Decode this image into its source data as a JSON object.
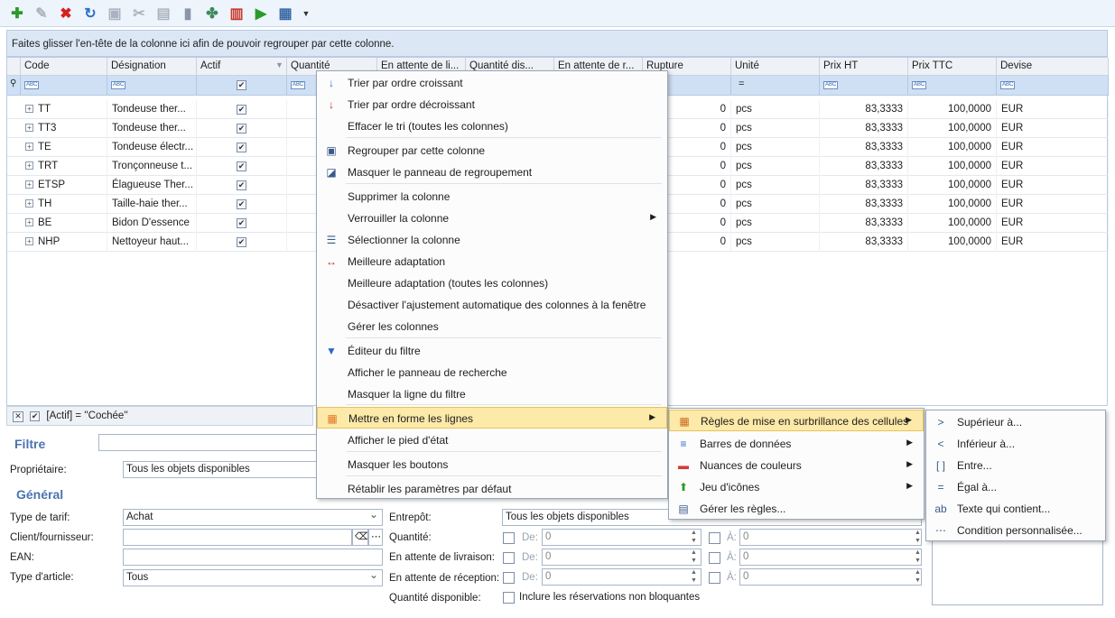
{
  "toolbar": {
    "icons": [
      "add-icon",
      "wrench-icon",
      "delete-icon",
      "refresh-icon",
      "edit-icon",
      "cut-icon",
      "paste-icon",
      "document-icon",
      "branch-icon",
      "chart-icon",
      "play-icon",
      "view-icon",
      "dropdown-arrow-icon"
    ]
  },
  "group_panel": {
    "text": "Faites glisser l'en-tête de la colonne ici afin de pouvoir regrouper par cette colonne."
  },
  "grid": {
    "columns": [
      "Code",
      "Désignation",
      "Actif",
      "Quantité",
      "En attente de li...",
      "Quantité dis...",
      "En attente de r...",
      "Rupture",
      "Unité",
      "Prix HT",
      "Prix TTC",
      "Devise"
    ],
    "rows": [
      {
        "code": "TT",
        "designation": "Tondeuse ther...",
        "rupture": "0",
        "unite": "pcs",
        "prix_ht": "83,3333",
        "prix_ttc": "100,0000",
        "devise": "EUR"
      },
      {
        "code": "TT3",
        "designation": "Tondeuse ther...",
        "rupture": "0",
        "unite": "pcs",
        "prix_ht": "83,3333",
        "prix_ttc": "100,0000",
        "devise": "EUR"
      },
      {
        "code": "TE",
        "designation": "Tondeuse électr...",
        "rupture": "0",
        "unite": "pcs",
        "prix_ht": "83,3333",
        "prix_ttc": "100,0000",
        "devise": "EUR"
      },
      {
        "code": "TRT",
        "designation": "Tronçonneuse t...",
        "rupture": "0",
        "unite": "pcs",
        "prix_ht": "83,3333",
        "prix_ttc": "100,0000",
        "devise": "EUR"
      },
      {
        "code": "ETSP",
        "designation": "Élagueuse Ther...",
        "rupture": "0",
        "unite": "pcs",
        "prix_ht": "83,3333",
        "prix_ttc": "100,0000",
        "devise": "EUR"
      },
      {
        "code": "TH",
        "designation": "Taille-haie ther...",
        "rupture": "0",
        "unite": "pcs",
        "prix_ht": "83,3333",
        "prix_ttc": "100,0000",
        "devise": "EUR"
      },
      {
        "code": "BE",
        "designation": "Bidon D'essence",
        "rupture": "0",
        "unite": "pcs",
        "prix_ht": "83,3333",
        "prix_ttc": "100,0000",
        "devise": "EUR"
      },
      {
        "code": "NHP",
        "designation": "Nettoyeur haut...",
        "rupture": "0",
        "unite": "pcs",
        "prix_ht": "83,3333",
        "prix_ttc": "100,0000",
        "devise": "EUR"
      }
    ]
  },
  "filter_bar": {
    "text": "[Actif] = ''Cochée''"
  },
  "form": {
    "filtre_title": "Filtre",
    "general_title": "Général",
    "proprietaire_label": "Propriétaire:",
    "proprietaire_value": "Tous les objets disponibles",
    "type_tarif_label": "Type de tarif:",
    "type_tarif_value": "Achat",
    "client_label": "Client/fournisseur:",
    "client_value": "",
    "ean_label": "EAN:",
    "ean_value": "",
    "type_article_label": "Type d'article:",
    "type_article_value": "Tous",
    "entrepot_label": "Entrepôt:",
    "entrepot_value": "Tous les objets disponibles",
    "quantite_label": "Quantité:",
    "attente_livraison_label": "En attente de livraison:",
    "attente_reception_label": "En attente de réception:",
    "qte_dispo_label": "Quantité disponible:",
    "reservations_label": "Inclure les réservations non bloquantes",
    "de_label": "De:",
    "a_label": "À:",
    "zero": "0"
  },
  "context_menu": {
    "items": [
      {
        "label": "Trier par ordre croissant",
        "icon": "sort-asc-icon"
      },
      {
        "label": "Trier par ordre décroissant",
        "icon": "sort-desc-icon"
      },
      {
        "label": "Effacer le tri (toutes les colonnes)",
        "icon": ""
      },
      {
        "label": "Regrouper par cette colonne",
        "icon": "group-icon"
      },
      {
        "label": "Masquer le panneau de regroupement",
        "icon": "hide-group-icon"
      },
      {
        "label": "Supprimer la colonne",
        "icon": ""
      },
      {
        "label": "Verrouiller la colonne",
        "icon": ""
      },
      {
        "label": "Sélectionner la colonne",
        "icon": "select-column-icon"
      },
      {
        "label": "Meilleure adaptation",
        "icon": "best-fit-icon"
      },
      {
        "label": "Meilleure adaptation (toutes les colonnes)",
        "icon": ""
      },
      {
        "label": "Désactiver l'ajustement automatique des colonnes à la fenêtre",
        "icon": ""
      },
      {
        "label": "Gérer les colonnes",
        "icon": ""
      },
      {
        "label": "Éditeur du filtre",
        "icon": "filter-icon"
      },
      {
        "label": "Afficher le panneau de recherche",
        "icon": ""
      },
      {
        "label": "Masquer la ligne du filtre",
        "icon": ""
      },
      {
        "label": "Mettre en forme les lignes",
        "icon": "format-rows-icon"
      },
      {
        "label": "Afficher le pied d'état",
        "icon": ""
      },
      {
        "label": "Masquer les boutons",
        "icon": ""
      },
      {
        "label": "Rétablir les paramètres par défaut",
        "icon": ""
      }
    ]
  },
  "submenu1": {
    "items": [
      {
        "label": "Règles de mise en surbrillance des cellules",
        "icon": "highlight-rules-icon"
      },
      {
        "label": "Barres de données",
        "icon": "data-bars-icon"
      },
      {
        "label": "Nuances de couleurs",
        "icon": "color-scale-icon"
      },
      {
        "label": "Jeu d'icônes",
        "icon": "icon-set-icon"
      },
      {
        "label": "Gérer les règles...",
        "icon": "manage-rules-icon"
      }
    ]
  },
  "submenu2": {
    "items": [
      {
        "label": "Supérieur à...",
        "icon": "greater-than-icon"
      },
      {
        "label": "Inférieur à...",
        "icon": "less-than-icon"
      },
      {
        "label": "Entre...",
        "icon": "between-icon"
      },
      {
        "label": "Égal à...",
        "icon": "equal-icon"
      },
      {
        "label": "Texte qui contient...",
        "icon": "text-contains-icon"
      },
      {
        "label": "Condition personnalisée...",
        "icon": "custom-condition-icon"
      }
    ]
  }
}
